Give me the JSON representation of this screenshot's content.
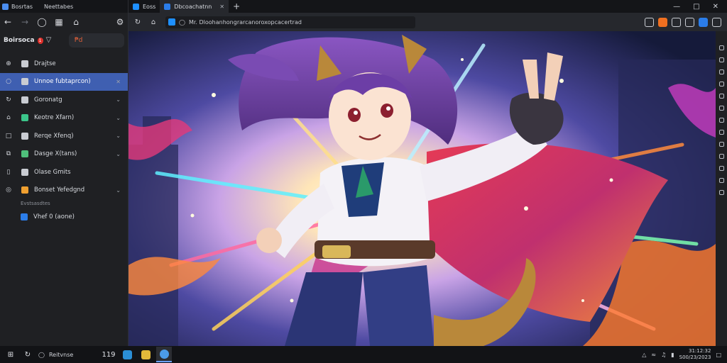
{
  "sidebar": {
    "tabs": [
      {
        "label": "Bosrtas",
        "color": "#4a8df0"
      },
      {
        "label": "Neettabes",
        "color": "#444"
      }
    ],
    "title": "Boirsoca",
    "badge": "1",
    "search_value": "₱d",
    "group_label": "Evstsasdtes",
    "items": [
      {
        "label": "Drajtse",
        "icon": "circle-plus-icon",
        "fav_color": "#c9ccd2",
        "has_chevron": false,
        "active": false
      },
      {
        "label": "Unnoe fubtaprcon)",
        "icon": "circle-icon",
        "fav_color": "#c9ccd2",
        "has_chevron": true,
        "active": true
      },
      {
        "label": "Goronatg",
        "icon": "refresh-icon",
        "fav_color": "#c9ccd2",
        "has_chevron": true,
        "active": false
      },
      {
        "label": "Keotre  Xfarn)",
        "icon": "home-icon",
        "fav_color": "#3bc58a",
        "has_chevron": true,
        "active": false
      },
      {
        "label": "Rerqe  Xfenq)",
        "icon": "box-icon",
        "fav_color": "#c9ccd2",
        "has_chevron": true,
        "active": false
      },
      {
        "label": "Dasge  X(tans)",
        "icon": "copy-icon",
        "fav_color": "#4fc07b",
        "has_chevron": true,
        "active": false
      },
      {
        "label": "Olase Gmits",
        "icon": "page-icon",
        "fav_color": "#c9ccd2",
        "has_chevron": false,
        "active": false
      },
      {
        "label": "Bonset  Yefedgnd",
        "icon": "globe-icon",
        "fav_color": "#f0a030",
        "has_chevron": true,
        "active": false
      }
    ],
    "group_items": [
      {
        "label": "Vhef 0 (aone)",
        "fav_color": "#2b7de9"
      }
    ]
  },
  "browser": {
    "tabs": [
      {
        "label": "Eoss",
        "active": false
      },
      {
        "label": "Dbcoachatnn",
        "active": true
      }
    ],
    "url": "Mr. Dloohanhongrarcanoroxopcacertrad",
    "nav_icons": [
      "reload-icon",
      "home-icon"
    ],
    "extensions": [
      {
        "name": "star-icon",
        "color": "#c9ccd2"
      },
      {
        "name": "orange-ext-icon",
        "color": "#f07020"
      },
      {
        "name": "shield-icon",
        "color": "#c9ccd2"
      },
      {
        "name": "people-icon",
        "color": "#c9ccd2"
      },
      {
        "name": "blue-ext-icon",
        "color": "#2b7de9"
      },
      {
        "name": "chat-icon",
        "color": "#c9ccd2"
      }
    ]
  },
  "taskbar": {
    "search_label": "Reitvnse",
    "pinned_text": "119",
    "tray_icons": [
      "upload-icon",
      "wifi-icon",
      "volume-icon",
      "battery-icon",
      "notification-icon"
    ],
    "clock_time": "31:12:32",
    "clock_date": "S00/23/2023"
  },
  "colors": {
    "accent": "#3f5fb1",
    "sidebar_bg": "#1f2023",
    "chrome_bg": "#26282d"
  }
}
